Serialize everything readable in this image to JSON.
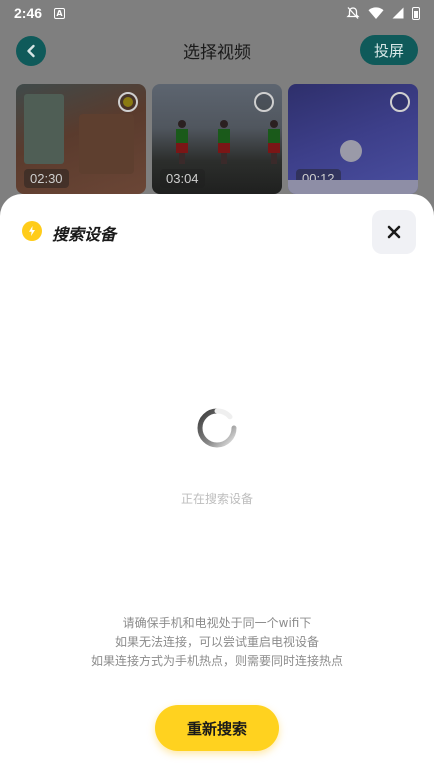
{
  "status_bar": {
    "time": "2:46",
    "notification_letter": "A",
    "icons": [
      "mute-icon",
      "wifi-icon",
      "signal-icon",
      "battery-icon"
    ]
  },
  "page": {
    "title": "选择视频",
    "cast_label": "投屏",
    "videos": [
      {
        "duration": "02:30",
        "selected": true
      },
      {
        "duration": "03:04",
        "selected": false
      },
      {
        "duration": "00:12",
        "selected": false
      }
    ]
  },
  "sheet": {
    "title": "搜索设备",
    "status": "正在搜索设备",
    "hints": [
      "请确保手机和电视处于同一个wifi下",
      "如果无法连接，可以尝试重启电视设备",
      "如果连接方式为手机热点，则需要同时连接热点"
    ],
    "retry_label": "重新搜索"
  },
  "colors": {
    "accent": "#ffd21f",
    "teal": "#0f5a5a",
    "overlay": "#7f7f7f"
  }
}
